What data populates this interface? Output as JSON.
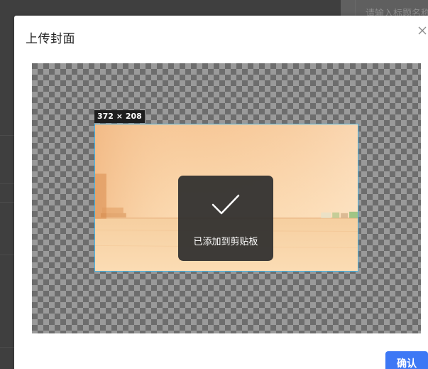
{
  "background": {
    "title_input_placeholder": "请输入标题名称"
  },
  "dialog": {
    "title": "上传封面",
    "close_icon": "close-icon",
    "confirm_label": "确认",
    "accent_color": "#3d78f5"
  },
  "cropper": {
    "crop_size_label": "372 × 208",
    "crop_border_color": "#47b7e8"
  },
  "toast": {
    "icon": "checkmark-icon",
    "message": "已添加到剪贴板"
  }
}
